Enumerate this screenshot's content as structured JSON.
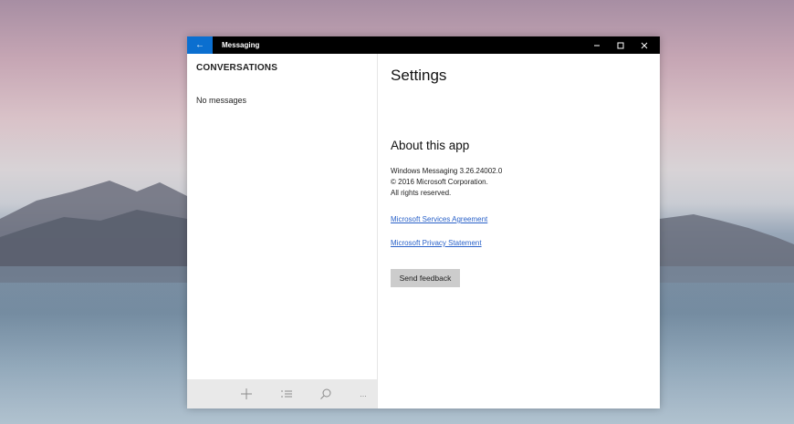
{
  "titlebar": {
    "app_title": "Messaging",
    "back_glyph": "←",
    "accent_color": "#0b6fd0",
    "icons": [
      "back-arrow-icon",
      "minimize-icon",
      "maximize-icon",
      "close-icon"
    ]
  },
  "left_pane": {
    "title": "CONVERSATIONS",
    "empty_text": "No messages",
    "toolbar_icons": [
      "add-icon",
      "select-icon",
      "search-icon",
      "more-icon"
    ],
    "more_glyph": "..."
  },
  "settings": {
    "title": "Settings",
    "about": {
      "heading": "About this app",
      "version": "Windows Messaging 3.26.24002.0",
      "copyright": "© 2016 Microsoft Corporation.",
      "rights": "All rights reserved."
    },
    "links": {
      "services_agreement": "Microsoft Services Agreement",
      "privacy_statement": "Microsoft Privacy Statement"
    },
    "feedback_button": "Send feedback"
  }
}
